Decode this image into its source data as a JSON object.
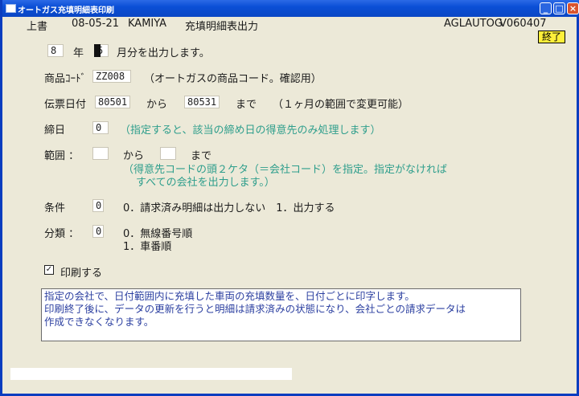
{
  "window": {
    "title": "オートガス充填明細表印刷"
  },
  "header": {
    "left": "上書",
    "date": "08-05-21",
    "user": "KAMIYA",
    "screen_title": "充填明細表出力",
    "program_id": "AGLAUTOG",
    "version": "V060407"
  },
  "end_button": "終了",
  "year_row": {
    "year_value": "8",
    "year_label": "年",
    "month_value": "5",
    "suffix": "月分を出力します。"
  },
  "product": {
    "label": "商品ｺｰﾄﾞ",
    "value": "ZZ008",
    "note": "（オートガスの商品コード。確認用）"
  },
  "slip_date": {
    "label": "伝票日付",
    "from_value": "80501",
    "from_label": "から",
    "to_value": "80531",
    "to_label": "まで",
    "note": "（１ヶ月の範囲で変更可能）"
  },
  "closing_day": {
    "label": "締日",
    "value": "0",
    "note": "（指定すると、該当の締め日の得意先のみ処理します）"
  },
  "range": {
    "label": "範囲 ：",
    "from_value": "",
    "from_label": "から",
    "to_value": "",
    "to_label": "まで",
    "note_line1": "（得意先コードの頭２ケタ（＝会社コード）を指定。指定がなければ",
    "note_line2": "すべての会社を出力します。）"
  },
  "condition": {
    "label": "条件",
    "value": "0",
    "options": "0．請求済み明細は出力しない　1．出力する"
  },
  "classification": {
    "label": "分類 ：",
    "value": "0",
    "option1": "0．無線番号順",
    "option2": "1．車番順"
  },
  "print_check": {
    "checked_mark": "✓",
    "label": "印刷する"
  },
  "message": {
    "line1": "指定の会社で、日付範囲内に充填した車両の充填数量を、日付ごとに印字します。",
    "line2": "印刷終了後に、データの更新を行うと明細は請求済みの状態になり、会社ごとの請求データは",
    "line3": "作成できなくなります。"
  },
  "colors": {
    "titlebar": "#0A46C4",
    "background": "#ECE9D8",
    "note_text": "#2E9E8C",
    "message_text": "#2B3FA0",
    "end_button": "#FFEF3A"
  }
}
